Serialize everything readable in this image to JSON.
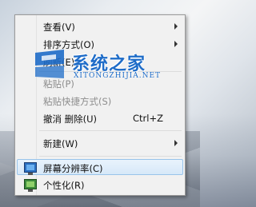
{
  "menu": {
    "items": [
      {
        "label": "查看(V)",
        "submenu": true,
        "disabled": false
      },
      {
        "label": "排序方式(O)",
        "submenu": true,
        "disabled": false
      },
      {
        "label": "刷新(E)",
        "submenu": false,
        "disabled": false
      },
      {
        "label": "粘贴(P)",
        "submenu": false,
        "disabled": true
      },
      {
        "label": "粘贴快捷方式(S)",
        "submenu": false,
        "disabled": true
      },
      {
        "label": "撤消 删除(U)",
        "shortcut": "Ctrl+Z",
        "submenu": false,
        "disabled": false
      },
      {
        "label": "新建(W)",
        "submenu": true,
        "disabled": false
      },
      {
        "label": "屏幕分辨率(C)",
        "icon": "monitor-icon",
        "highlighted": true
      },
      {
        "label": "个性化(R)",
        "icon": "personalize-icon"
      }
    ]
  },
  "watermark": {
    "title": "系统之家",
    "subtitle": "XITONGZHIJIA.NET"
  },
  "colors": {
    "menu_bg": "#f1f1f1",
    "highlight_border": "#99c4ea",
    "watermark_blue": "#1e6cc8"
  }
}
